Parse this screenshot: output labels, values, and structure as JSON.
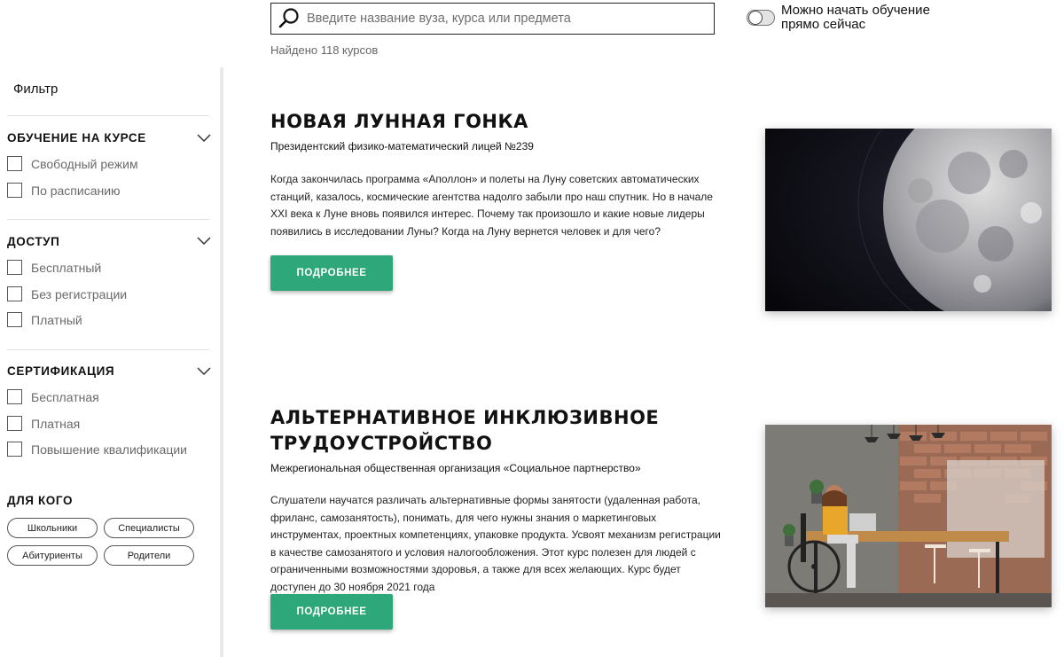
{
  "search": {
    "placeholder": "Введите название вуза, курса или предмета",
    "icon": "search-icon",
    "found_text": "Найдено 118 курсов"
  },
  "toggle": {
    "label": "Можно начать обучение прямо сейчас",
    "on": false
  },
  "sidebar": {
    "title": "Фильтр",
    "sections": [
      {
        "title": "ОБУЧЕНИЕ НА КУРСЕ",
        "options": [
          "Свободный режим",
          "По расписанию"
        ]
      },
      {
        "title": "ДОСТУП",
        "options": [
          "Бесплатный",
          "Без регистрации",
          "Платный"
        ]
      },
      {
        "title": "СЕРТИФИКАЦИЯ",
        "options": [
          "Бесплатная",
          "Платная",
          "Повышение квалификации"
        ]
      }
    ],
    "audience": {
      "title": "ДЛЯ КОГО",
      "pills": [
        "Школьники",
        "Специалисты",
        "Абитуриенты",
        "Родители"
      ]
    }
  },
  "courses": [
    {
      "title": "НОВАЯ ЛУННАЯ ГОНКА",
      "org": "Президентский физико-математический лицей №239",
      "description": "Когда закончилась программа «Аполлон» и полеты на Луну советских автоматических станций, казалось, космические агентства надолго забыли про наш спутник. Но в начале XXI века к Луне вновь появился интерес. Почему так произошло и какие новые лидеры появились в исследовании Луны? Когда на Луну вернется человек и для чего?",
      "button": "ПОДРОБНЕЕ"
    },
    {
      "title_line1": "АЛЬТЕРНАТИВНОЕ ИНКЛЮЗИВНОЕ",
      "title_line2": "ТРУДОУСТРОЙСТВО",
      "org": "Межрегиональная общественная организация «Социальное партнерство»",
      "description": "Слушатели научатся различать альтернативные формы занятости (удаленная работа, фриланс, самозанятость), понимать, для чего нужны знания о маркетинговых инструментах, проектных компетенциях, упаковке продукта. Усвоят механизм регистрации в качестве самозанятого и условия налогообложения. Этот курс полезен для людей с ограниченными возможностями здоровья, а также для всех желающих. Курс будет доступен до 30 ноября 2021 года",
      "button": "ПОДРОБНЕЕ"
    }
  ],
  "colors": {
    "accent": "#2ea87a",
    "sidebar_border": "#e9e9e9"
  }
}
